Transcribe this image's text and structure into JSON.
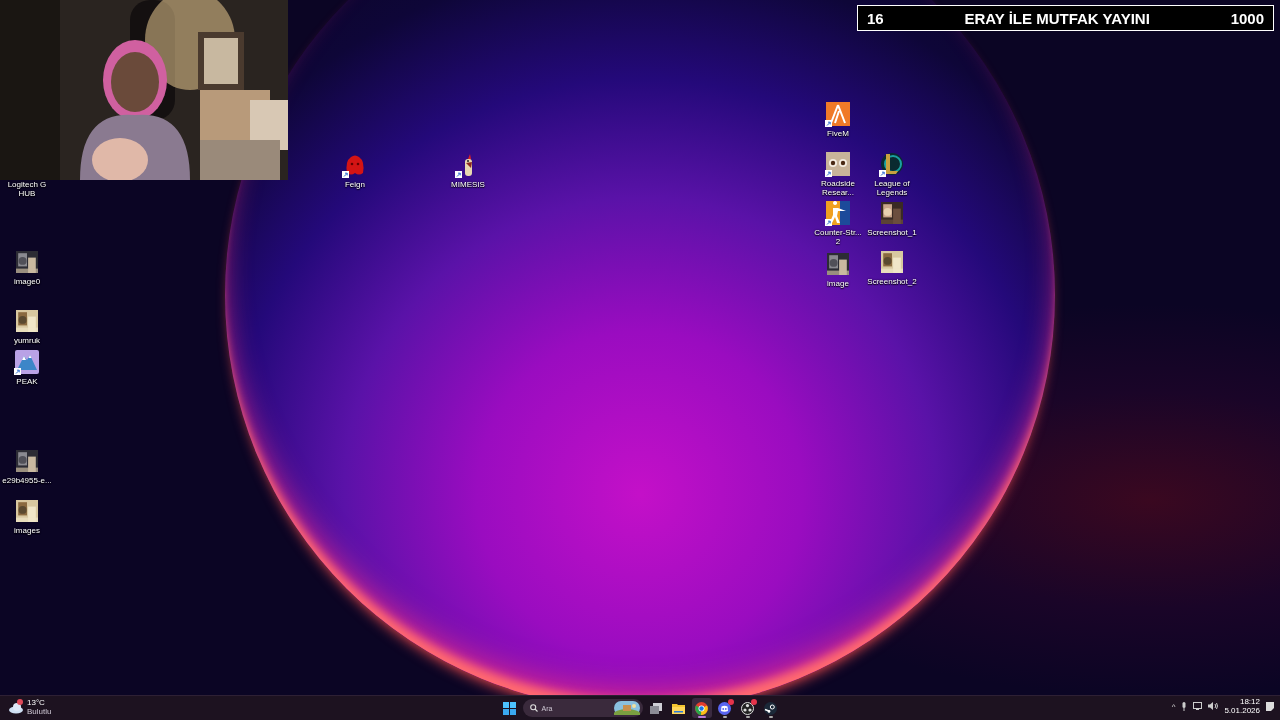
{
  "stream_overlay": {
    "count": "16",
    "title": "ERAY İLE MUTFAK YAYINI",
    "goal": "1000"
  },
  "desktop_icons": [
    {
      "label": "Logitech G HUB",
      "kind": "hidden",
      "shortcut": false
    },
    {
      "label": "image0",
      "shortcut": false
    },
    {
      "label": "yumruk",
      "shortcut": false
    },
    {
      "label": "PEAK",
      "kind": "mountain",
      "shortcut": true
    },
    {
      "label": "e29b4955-e...",
      "shortcut": false
    },
    {
      "label": "images",
      "shortcut": false
    },
    {
      "label": "Feign",
      "kind": "creature",
      "shortcut": true
    },
    {
      "label": "MIMESIS",
      "kind": "rooster",
      "shortcut": true
    },
    {
      "label": "FiveM",
      "kind": "fivem",
      "shortcut": true
    },
    {
      "label": "Roadside Resear...",
      "kind": "eyes",
      "shortcut": true
    },
    {
      "label": "League of Legends",
      "kind": "league",
      "shortcut": true
    },
    {
      "label": "Counter-Str... 2",
      "kind": "soldier",
      "shortcut": true
    },
    {
      "label": "Screenshot_1",
      "shortcut": false
    },
    {
      "label": "image",
      "shortcut": false
    },
    {
      "label": "Screenshot_2",
      "shortcut": false
    }
  ],
  "taskbar": {
    "weather": {
      "temperature": "13°C",
      "condition": "Bulutlu",
      "alert": true
    },
    "search": {
      "placeholder": "Ara"
    },
    "apps": [
      {
        "kind": "start",
        "running": false,
        "active": false,
        "badge": false
      },
      {
        "kind": "taskview",
        "running": false,
        "active": false,
        "badge": false
      },
      {
        "kind": "explorer",
        "running": false,
        "active": false,
        "badge": false
      },
      {
        "kind": "chrome",
        "running": true,
        "active": true,
        "badge": false
      },
      {
        "kind": "discord",
        "running": true,
        "active": false,
        "badge": true
      },
      {
        "kind": "obs",
        "running": true,
        "active": false,
        "badge": true
      },
      {
        "kind": "steam",
        "running": true,
        "active": false,
        "badge": false
      }
    ],
    "tray": {
      "chevron": "^",
      "time": "18:12",
      "date": "5.01.2026"
    }
  }
}
